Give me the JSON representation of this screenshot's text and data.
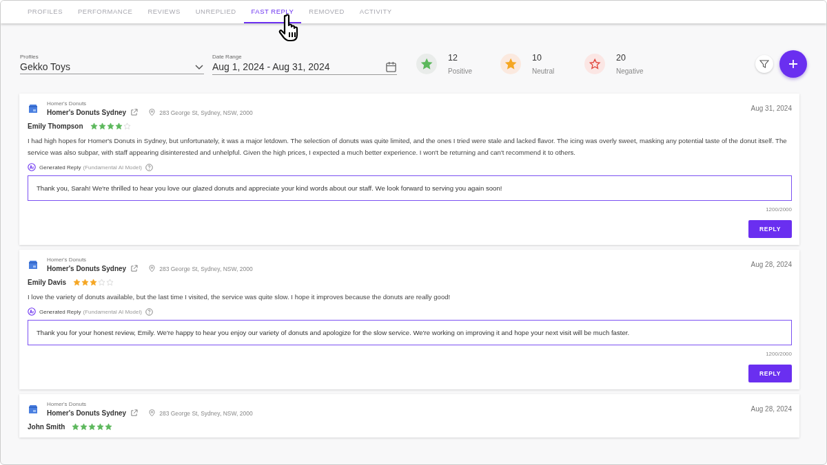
{
  "tabs": [
    {
      "label": "PROFILES",
      "selected": false
    },
    {
      "label": "PERFORMANCE",
      "selected": false
    },
    {
      "label": "REVIEWS",
      "selected": false
    },
    {
      "label": "UNREPLIED",
      "selected": false
    },
    {
      "label": "FAST REPLY",
      "selected": true
    },
    {
      "label": "REMOVED",
      "selected": false
    },
    {
      "label": "ACTIVITY",
      "selected": false
    }
  ],
  "filters": {
    "profiles": {
      "label": "Profiles",
      "value": "Gekko Toys"
    },
    "date_range": {
      "label": "Date Range",
      "value": "Aug 1, 2024 - Aug 31, 2024"
    }
  },
  "summary": [
    {
      "kind": "positive",
      "count": "12",
      "label": "Positive"
    },
    {
      "kind": "neutral",
      "count": "10",
      "label": "Neutral"
    },
    {
      "kind": "negative",
      "count": "20",
      "label": "Negative"
    }
  ],
  "reviews": [
    {
      "brand": "Homer's Donuts",
      "location": "Homer's Donuts Sydney",
      "address": "283 George St, Sydney, NSW, 2000",
      "date": "Aug 31, 2024",
      "reviewer": "Emily Thompson",
      "stars": 4,
      "color": "#5cb85c",
      "text": "I had high hopes for Homer's Donuts in Sydney, but unfortunately, it was a major letdown. The selection of donuts was quite limited, and the ones I tried were stale and lacked flavor. The icing was overly sweet, masking any potential taste of the donut itself. The service was also subpar, with staff appearing disinterested and unhelpful. Given the high prices, I expected a much better experience. I won't be returning and can't recommend it to others.",
      "reply_label": "Generated Reply",
      "reply_model": "(Fundamental AI Model)",
      "reply": "Thank you, Sarah! We're thrilled to hear you love our glazed donuts and appreciate your kind words about our staff. We look forward to serving you again soon!",
      "counter": "1200/2000",
      "button": "REPLY"
    },
    {
      "brand": "Homer's Donuts",
      "location": "Homer's Donuts Sydney",
      "address": "283 George St, Sydney, NSW, 2000",
      "date": "Aug 28, 2024",
      "reviewer": "Emily Davis",
      "stars": 3,
      "color": "#f5a623",
      "text": "I love the variety of donuts available, but the last time I visited, the service was quite slow. I hope it improves because the donuts are really good!",
      "reply_label": "Generated Reply",
      "reply_model": "(Fundamental AI Model)",
      "reply": "Thank you for your honest review, Emily. We're happy to hear you enjoy our variety of donuts and apologize for the slow service. We're working on improving it and hope your next visit will be much faster.",
      "counter": "1200/2000",
      "button": "REPLY"
    },
    {
      "brand": "Homer's Donuts",
      "location": "Homer's Donuts Sydney",
      "address": "283 George St, Sydney, NSW, 2000",
      "date": "Aug 28, 2024",
      "reviewer": "John Smith",
      "stars": 5,
      "color": "#5cb85c"
    }
  ]
}
